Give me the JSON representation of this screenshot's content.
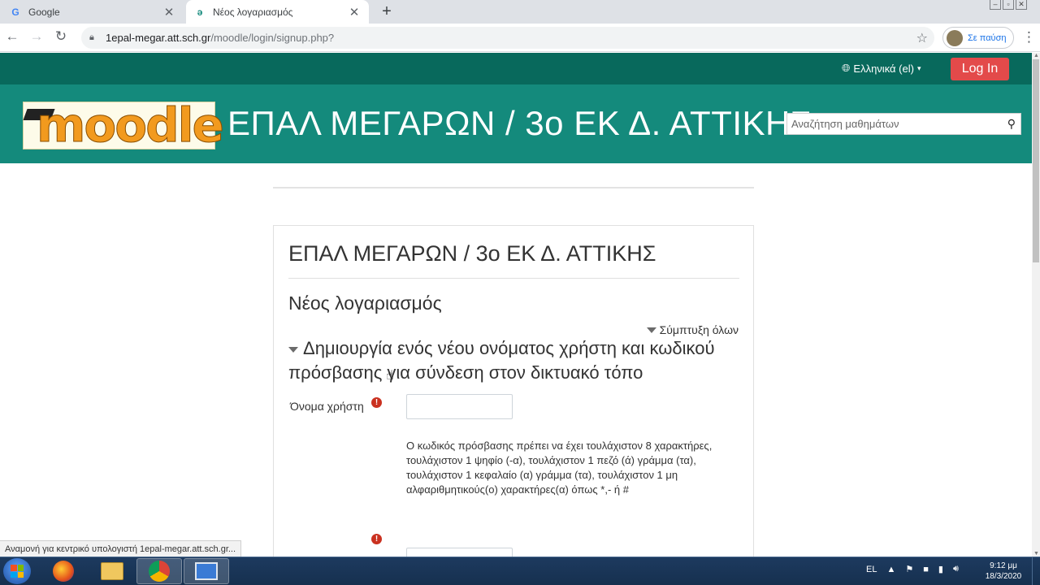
{
  "browser": {
    "tabs": [
      {
        "title": "Google",
        "favicon": "google-g-icon"
      },
      {
        "title": "Νέος λογαριασμός",
        "favicon": "moodle-m-icon"
      }
    ],
    "address": {
      "host": "1epal-megar.att.sch.gr",
      "path": "/moodle/login/signup.php?"
    },
    "profile_label": "Σε παύση",
    "status_text": "Αναμονή για κεντρικό υπολογιστή 1epal-megar.att.sch.gr..."
  },
  "moodle": {
    "language": "Ελληνικά (el)",
    "login_label": "Log In",
    "logo_text": "moodle",
    "site_title": "ΕΠΑΛ ΜΕΓΑΡΩΝ / 3ο ΕΚ Δ. ΑΤΤΙΚΗΣ",
    "search_placeholder": "Αναζήτηση μαθημάτων",
    "card": {
      "title": "ΕΠΑΛ ΜΕΓΑΡΩΝ / 3ο ΕΚ Δ. ΑΤΤΙΚΗΣ",
      "subtitle": "Νέος λογαριασμός",
      "collapse_all": "Σύμπτυξη όλων",
      "section_heading": "Δημιουργία ενός νέου ονόματος χρήστη και κωδικού πρόσβασης για σύνδεση στον δικτυακό τόπο",
      "username_label": "Όνομα χρήστη",
      "password_hint": "Ο κωδικός πρόσβασης πρέπει να έχει τουλάχιστον 8 χαρακτήρες, τουλάχιστον 1 ψηφίο (-α), τουλάχιστον 1 πεζό (ά) γράμμα (τα), τουλάχιστον 1 κεφαλαίο (α) γράμμα (τα), τουλάχιστον 1 μη αλφαριθμητικούς(ο) χαρακτήρες(α) όπως *,- ή #"
    }
  },
  "taskbar": {
    "lang": "EL",
    "time": "9:12 μμ",
    "date": "18/3/2020"
  },
  "colors": {
    "topbar": "#08695c",
    "header": "#148a7c",
    "login_button": "#e34a4a",
    "required": "#ca3120"
  }
}
